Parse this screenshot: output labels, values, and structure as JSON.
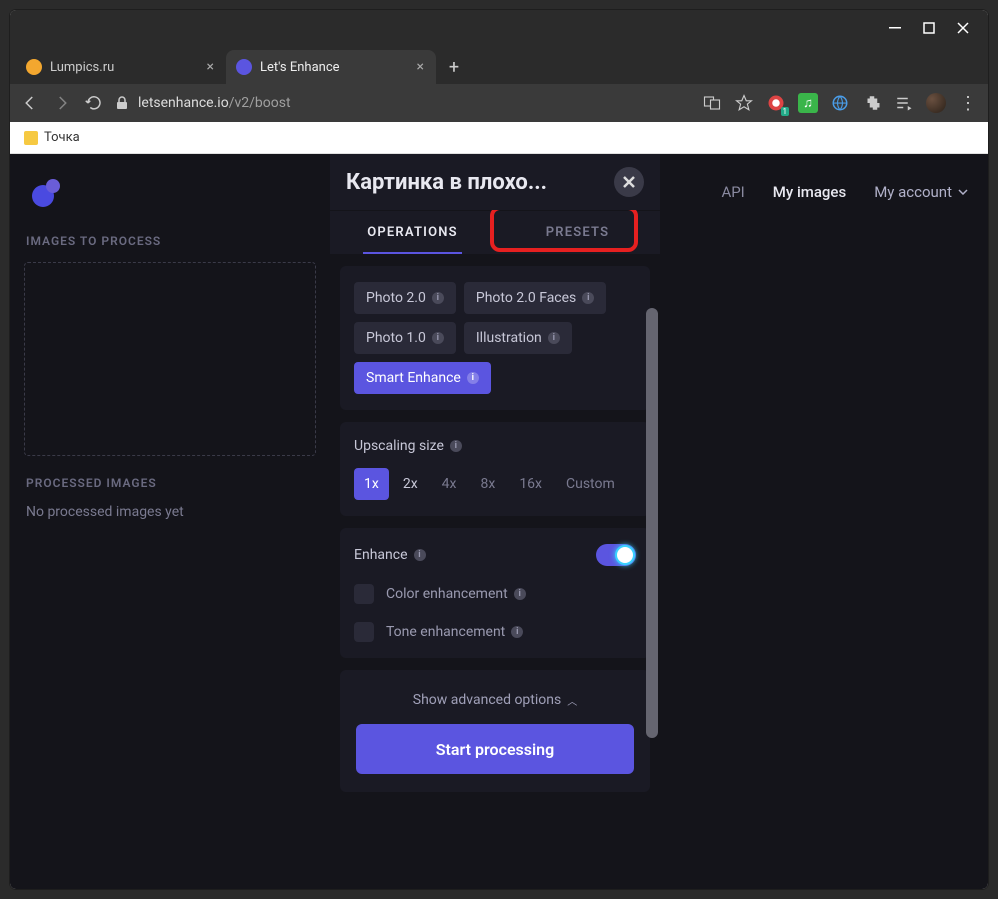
{
  "window": {
    "tabs": [
      {
        "title": "Lumpics.ru",
        "active": false,
        "favicon": "#f3a72f"
      },
      {
        "title": "Let's Enhance",
        "active": true,
        "favicon": "#5b55e0"
      }
    ]
  },
  "urlbar": {
    "domain": "letsenhance.io",
    "path": "/v2/boost"
  },
  "bookmarks": {
    "item1": "Точка"
  },
  "nav": {
    "api": "API",
    "my_images": "My images",
    "my_account": "My account"
  },
  "left": {
    "images_to_process": "IMAGES TO PROCESS",
    "processed_images": "PROCESSED IMAGES",
    "no_processed": "No processed images yet"
  },
  "panel": {
    "title": "Картинка в плохо...",
    "tabs": {
      "operations": "OPERATIONS",
      "presets": "PRESETS"
    },
    "modes": {
      "photo20": "Photo 2.0",
      "photo20faces": "Photo 2.0 Faces",
      "photo10": "Photo 1.0",
      "illustration": "Illustration",
      "smart": "Smart Enhance"
    },
    "upscaling_label": "Upscaling size",
    "sizes": {
      "x1": "1x",
      "x2": "2x",
      "x4": "4x",
      "x8": "8x",
      "x16": "16x",
      "custom": "Custom"
    },
    "enhance_label": "Enhance",
    "color_enh": "Color enhancement",
    "tone_enh": "Tone enhancement",
    "show_advanced": "Show advanced options",
    "start": "Start processing"
  }
}
